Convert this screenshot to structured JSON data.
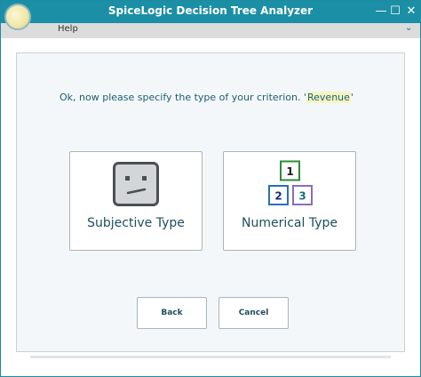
{
  "window": {
    "title": "SpiceLogic Decision Tree Analyzer",
    "minimize_glyph": "—",
    "maximize_glyph": "☐",
    "close_glyph": "✕"
  },
  "menu": {
    "help_label": "Help",
    "chevron_glyph": "⌄"
  },
  "prompt": {
    "text": "Ok, now please specify the type of your criterion.",
    "quote_open": "'",
    "criterion": "Revenue",
    "quote_close": "'"
  },
  "types": {
    "subjective_label": "Subjective Type",
    "numerical_label": "Numerical Type",
    "numerical_icon_digits": [
      "1",
      "2",
      "3"
    ]
  },
  "buttons": {
    "back_label": "Back",
    "cancel_label": "Cancel"
  },
  "colors": {
    "titlebar": "#1b8fa5",
    "accent_text": "#1d5f70",
    "criterion_highlight": "#f4f5c4",
    "digit_green": "#2e8b3a",
    "digit_blue": "#2a6fb8",
    "digit_purple": "#8a6cc0"
  }
}
